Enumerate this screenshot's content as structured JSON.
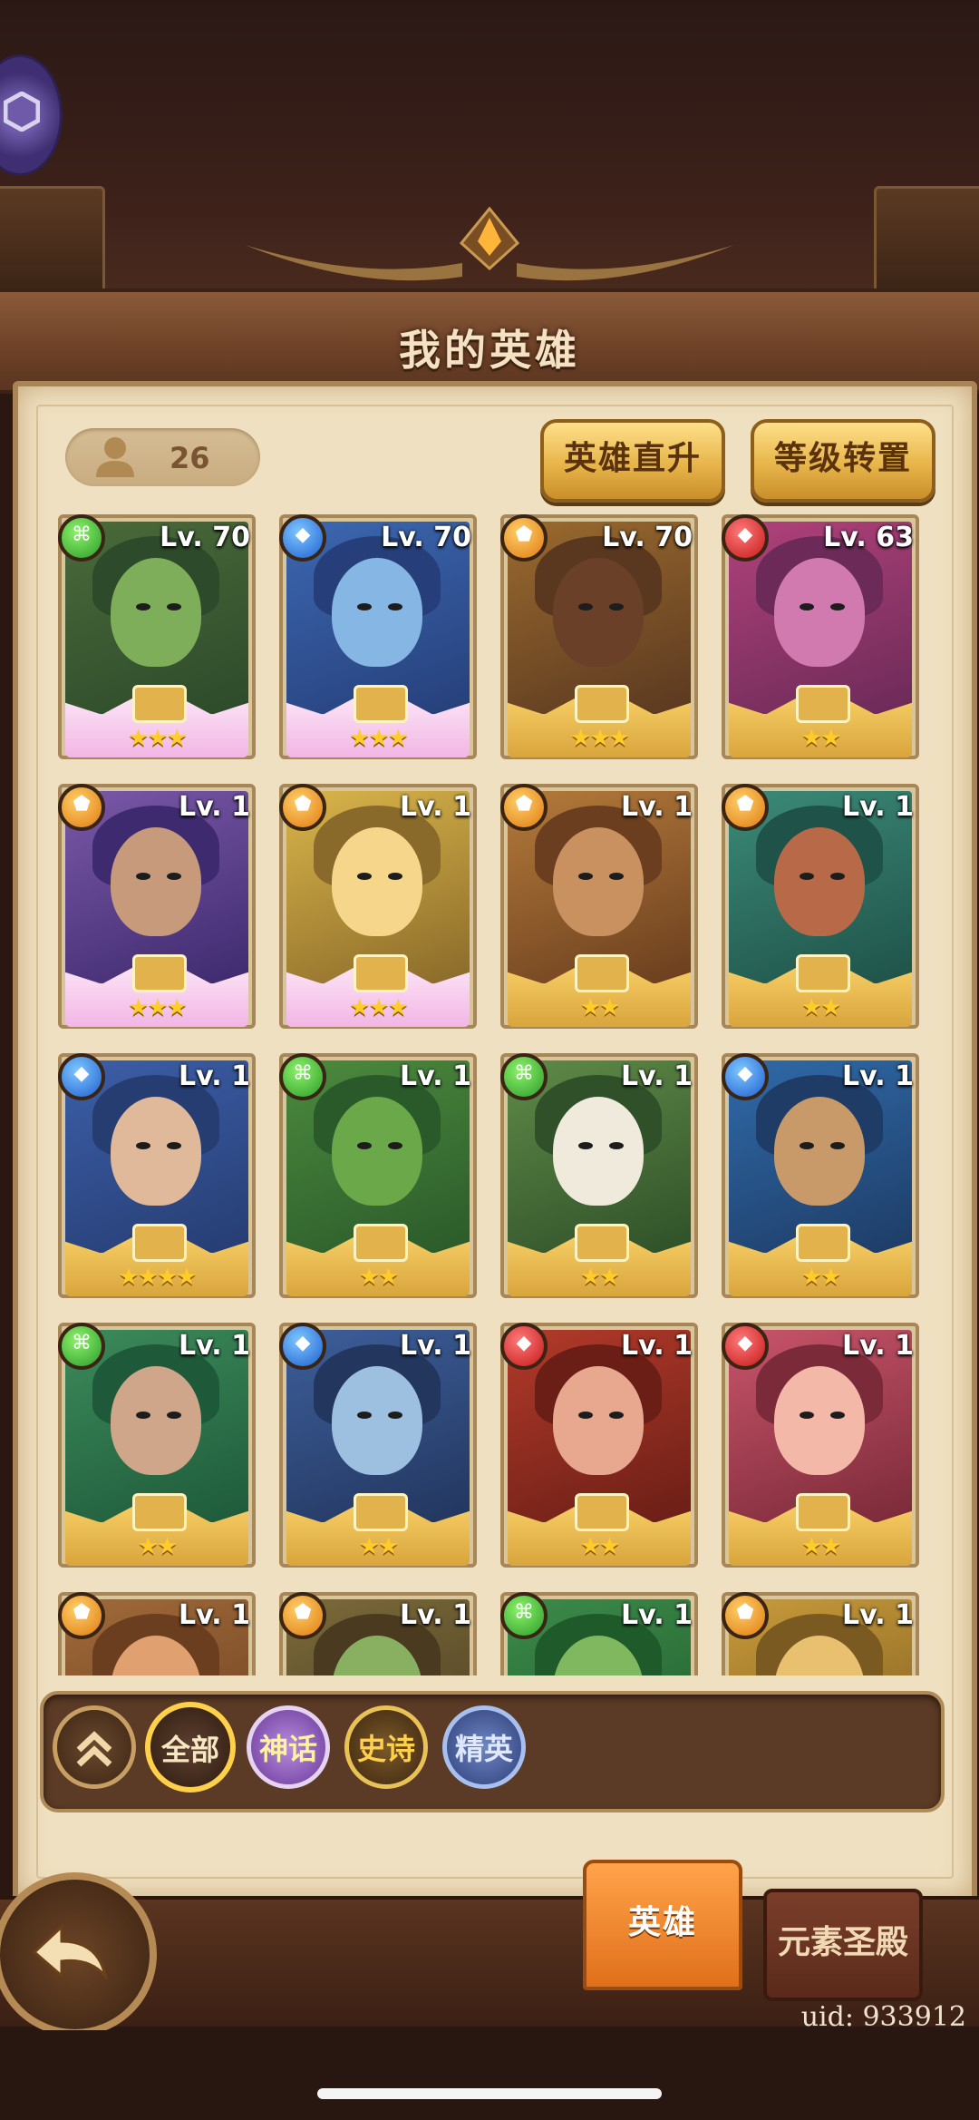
{
  "header": {
    "title": "我的英雄"
  },
  "hero_count": "26",
  "actions": {
    "upgrade_label": "英雄直升",
    "transfer_label": "等级转置"
  },
  "heroes": [
    {
      "level": "Lv. 70",
      "element": "green",
      "stars": "★★★"
    },
    {
      "level": "Lv. 70",
      "element": "blue",
      "stars": "★★★"
    },
    {
      "level": "Lv. 70",
      "element": "orange",
      "stars": "★★★"
    },
    {
      "level": "Lv. 63",
      "element": "red",
      "stars": "★★"
    },
    {
      "level": "Lv. 1",
      "element": "orange",
      "stars": "★★★"
    },
    {
      "level": "Lv. 1",
      "element": "orange",
      "stars": "★★★"
    },
    {
      "level": "Lv. 1",
      "element": "orange",
      "stars": "★★"
    },
    {
      "level": "Lv. 1",
      "element": "orange",
      "stars": "★★"
    },
    {
      "level": "Lv. 1",
      "element": "blue",
      "stars": "★★★★"
    },
    {
      "level": "Lv. 1",
      "element": "green",
      "stars": "★★"
    },
    {
      "level": "Lv. 1",
      "element": "green",
      "stars": "★★"
    },
    {
      "level": "Lv. 1",
      "element": "blue",
      "stars": "★★"
    },
    {
      "level": "Lv. 1",
      "element": "green",
      "stars": "★★"
    },
    {
      "level": "Lv. 1",
      "element": "blue",
      "stars": "★★"
    },
    {
      "level": "Lv. 1",
      "element": "red",
      "stars": "★★"
    },
    {
      "level": "Lv. 1",
      "element": "red",
      "stars": "★★"
    },
    {
      "level": "Lv. 1",
      "element": "orange",
      "stars": ""
    },
    {
      "level": "Lv. 1",
      "element": "orange",
      "stars": ""
    },
    {
      "level": "Lv. 1",
      "element": "green",
      "stars": ""
    },
    {
      "level": "Lv. 1",
      "element": "orange",
      "stars": ""
    }
  ],
  "filters": {
    "all": "全部",
    "myth": "神话",
    "epic": "史诗",
    "elite": "精英"
  },
  "tabs": {
    "heroes": "英雄",
    "temple": "元素圣殿"
  },
  "uid": "uid: 933912",
  "colors": {
    "accent_gold": "#e7b54a",
    "tab_active": "#e0701a",
    "panel_bg": "#efe0c1"
  }
}
